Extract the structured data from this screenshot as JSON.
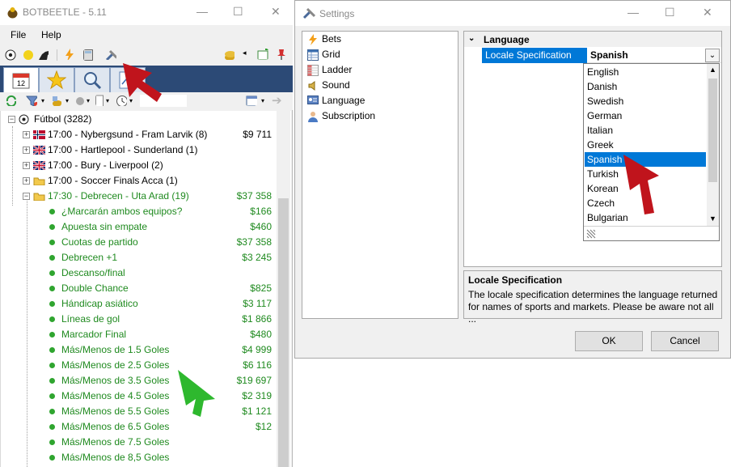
{
  "main_window": {
    "title": "BOTBEETLE - 5.11",
    "min_glyph": "—",
    "max_glyph": "☐",
    "close_glyph": "✕",
    "menu": [
      "File",
      "Help"
    ],
    "tree": {
      "root": "Fútbol (3282)",
      "events": [
        {
          "label": "17:00 - Nybergsund - Fram Larvik (8)",
          "amount": "$9 711",
          "flag": "norway-flag-icon"
        },
        {
          "label": "17:00 - Hartlepool - Sunderland (1)",
          "amount": "",
          "flag": "uk-flag-icon"
        },
        {
          "label": "17:00 - Bury - Liverpool (2)",
          "amount": "",
          "flag": "uk-flag-icon"
        },
        {
          "label": "17:00 - Soccer Finals Acca (1)",
          "amount": "",
          "flag": "folder-icon"
        },
        {
          "label": "17:30 - Debrecen - Uta Arad (19)",
          "amount": "$37 358",
          "flag": "folder-icon"
        }
      ],
      "markets": [
        {
          "label": "¿Marcarán ambos equipos?",
          "amount": "$166"
        },
        {
          "label": "Apuesta sin empate",
          "amount": "$460"
        },
        {
          "label": "Cuotas de partido",
          "amount": "$37 358"
        },
        {
          "label": "Debrecen +1",
          "amount": "$3 245"
        },
        {
          "label": "Descanso/final",
          "amount": ""
        },
        {
          "label": "Double Chance",
          "amount": "$825"
        },
        {
          "label": "Hándicap asiático",
          "amount": "$3 117"
        },
        {
          "label": "Líneas de gol",
          "amount": "$1 866"
        },
        {
          "label": "Marcador Final",
          "amount": "$480"
        },
        {
          "label": "Más/Menos de 1.5 Goles",
          "amount": "$4 999"
        },
        {
          "label": "Más/Menos de 2.5 Goles",
          "amount": "$6 116"
        },
        {
          "label": "Más/Menos de 3.5 Goles",
          "amount": "$19 697"
        },
        {
          "label": "Más/Menos de 4.5 Goles",
          "amount": "$2 319"
        },
        {
          "label": "Más/Menos de 5.5 Goles",
          "amount": "$1 121"
        },
        {
          "label": "Más/Menos de 6.5 Goles",
          "amount": "$12"
        },
        {
          "label": "Más/Menos de 7.5 Goles",
          "amount": ""
        },
        {
          "label": "Más/Menos de 8,5 Goles",
          "amount": ""
        }
      ]
    }
  },
  "settings": {
    "title": "Settings",
    "min_glyph": "—",
    "max_glyph": "☐",
    "close_glyph": "✕",
    "nav": [
      {
        "label": "Bets",
        "icon": "lightning-icon"
      },
      {
        "label": "Grid",
        "icon": "grid-icon"
      },
      {
        "label": "Ladder",
        "icon": "ladder-icon"
      },
      {
        "label": "Sound",
        "icon": "speaker-icon"
      },
      {
        "label": "Language",
        "icon": "language-icon"
      },
      {
        "label": "Subscription",
        "icon": "user-icon"
      }
    ],
    "group": "Language",
    "property_name": "Locale Specification",
    "property_value": "Spanish",
    "options": [
      "English",
      "Danish",
      "Swedish",
      "German",
      "Italian",
      "Greek",
      "Spanish",
      "Turkish",
      "Korean",
      "Czech",
      "Bulgarian"
    ],
    "selected_option": "Spanish",
    "description_title": "Locale Specification",
    "description_text": "The locale specification determines the language returned for names of sports and markets. Please be aware not all ...",
    "ok_label": "OK",
    "cancel_label": "Cancel"
  },
  "colors": {
    "selection": "#0078d7",
    "tab_strip": "#2c4a76",
    "market_text": "#1f8a1f",
    "red_arrow": "#c0141c",
    "green_arrow": "#2eb82e"
  }
}
